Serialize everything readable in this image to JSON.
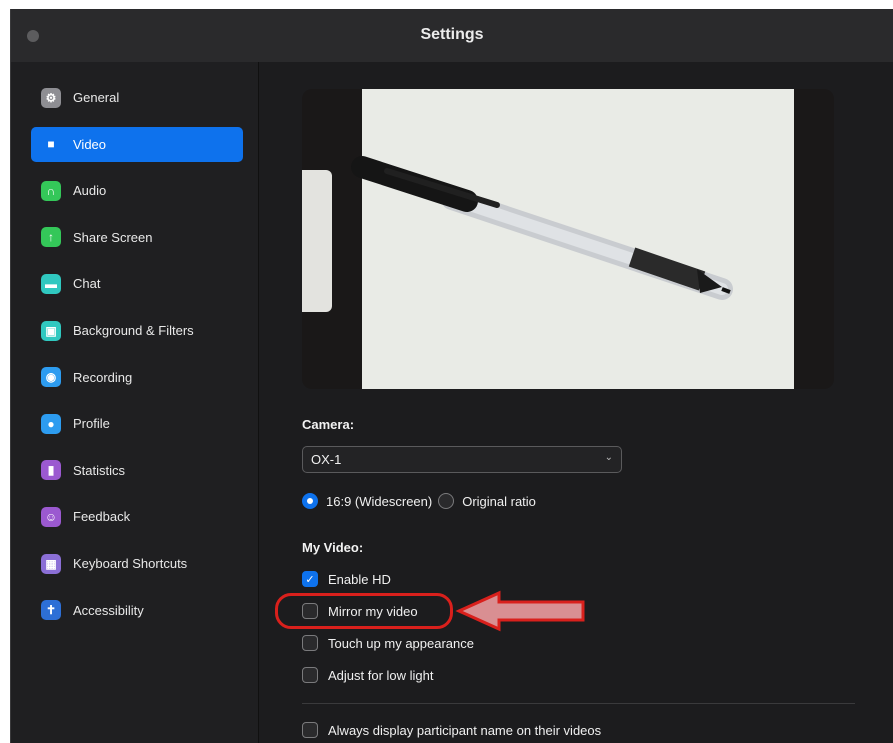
{
  "window": {
    "title": "Settings"
  },
  "sidebar": {
    "items": [
      {
        "label": "General",
        "icon": "gear-icon",
        "color": "#8e8e93",
        "glyph": "⚙"
      },
      {
        "label": "Video",
        "icon": "video-camera-icon",
        "color": "#0e72ed",
        "glyph": "■",
        "active": true
      },
      {
        "label": "Audio",
        "icon": "headphones-icon",
        "color": "#34c759",
        "glyph": "∩"
      },
      {
        "label": "Share Screen",
        "icon": "share-screen-icon",
        "color": "#34c759",
        "glyph": "↑"
      },
      {
        "label": "Chat",
        "icon": "chat-bubble-icon",
        "color": "#30c8c0",
        "glyph": "▬"
      },
      {
        "label": "Background & Filters",
        "icon": "person-portrait-icon",
        "color": "#30c8c0",
        "glyph": "▣"
      },
      {
        "label": "Recording",
        "icon": "record-icon",
        "color": "#2d9cf0",
        "glyph": "◉"
      },
      {
        "label": "Profile",
        "icon": "user-icon",
        "color": "#2d9cf0",
        "glyph": "●"
      },
      {
        "label": "Statistics",
        "icon": "bar-chart-icon",
        "color": "#9b59d0",
        "glyph": "▮"
      },
      {
        "label": "Feedback",
        "icon": "smiley-icon",
        "color": "#9b59d0",
        "glyph": "☺"
      },
      {
        "label": "Keyboard Shortcuts",
        "icon": "keyboard-icon",
        "color": "#8b6fd6",
        "glyph": "▦"
      },
      {
        "label": "Accessibility",
        "icon": "accessibility-icon",
        "color": "#2d6fd6",
        "glyph": "✝"
      }
    ]
  },
  "camera": {
    "label": "Camera:",
    "selected": "OX-1",
    "ratio_options": [
      "16:9 (Widescreen)",
      "Original ratio"
    ],
    "ratio_selected": "16:9 (Widescreen)"
  },
  "my_video": {
    "label": "My Video:",
    "options": [
      {
        "label": "Enable HD",
        "checked": true
      },
      {
        "label": "Mirror my video",
        "checked": false
      },
      {
        "label": "Touch up my appearance",
        "checked": false
      },
      {
        "label": "Adjust for low light",
        "checked": false
      }
    ]
  },
  "display": {
    "always_name_label": "Always display participant name on their videos",
    "always_name_checked": false
  },
  "annotation": {
    "color": "#d9201c"
  }
}
